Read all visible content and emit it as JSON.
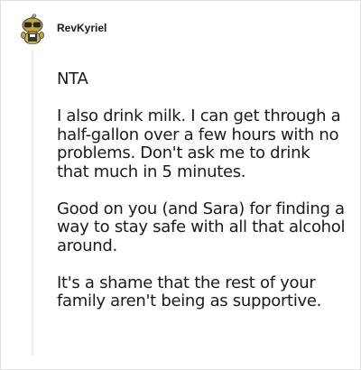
{
  "comment": {
    "username": "RevKyriel",
    "avatar_icon": "snoo-avatar-icon",
    "paragraphs": [
      "NTA",
      "I also drink milk. I can get through a half-gallon over a few hours with no problems. Don't ask me to drink that much in 5 minutes.",
      "Good on you (and Sara) for finding a way to stay safe with all that alcohol around.",
      "It's a shame that the rest of your family aren't being as supportive."
    ]
  },
  "colors": {
    "text": "#1a1a1b",
    "thread_line": "#edeff1",
    "border": "#e0e0e0"
  }
}
